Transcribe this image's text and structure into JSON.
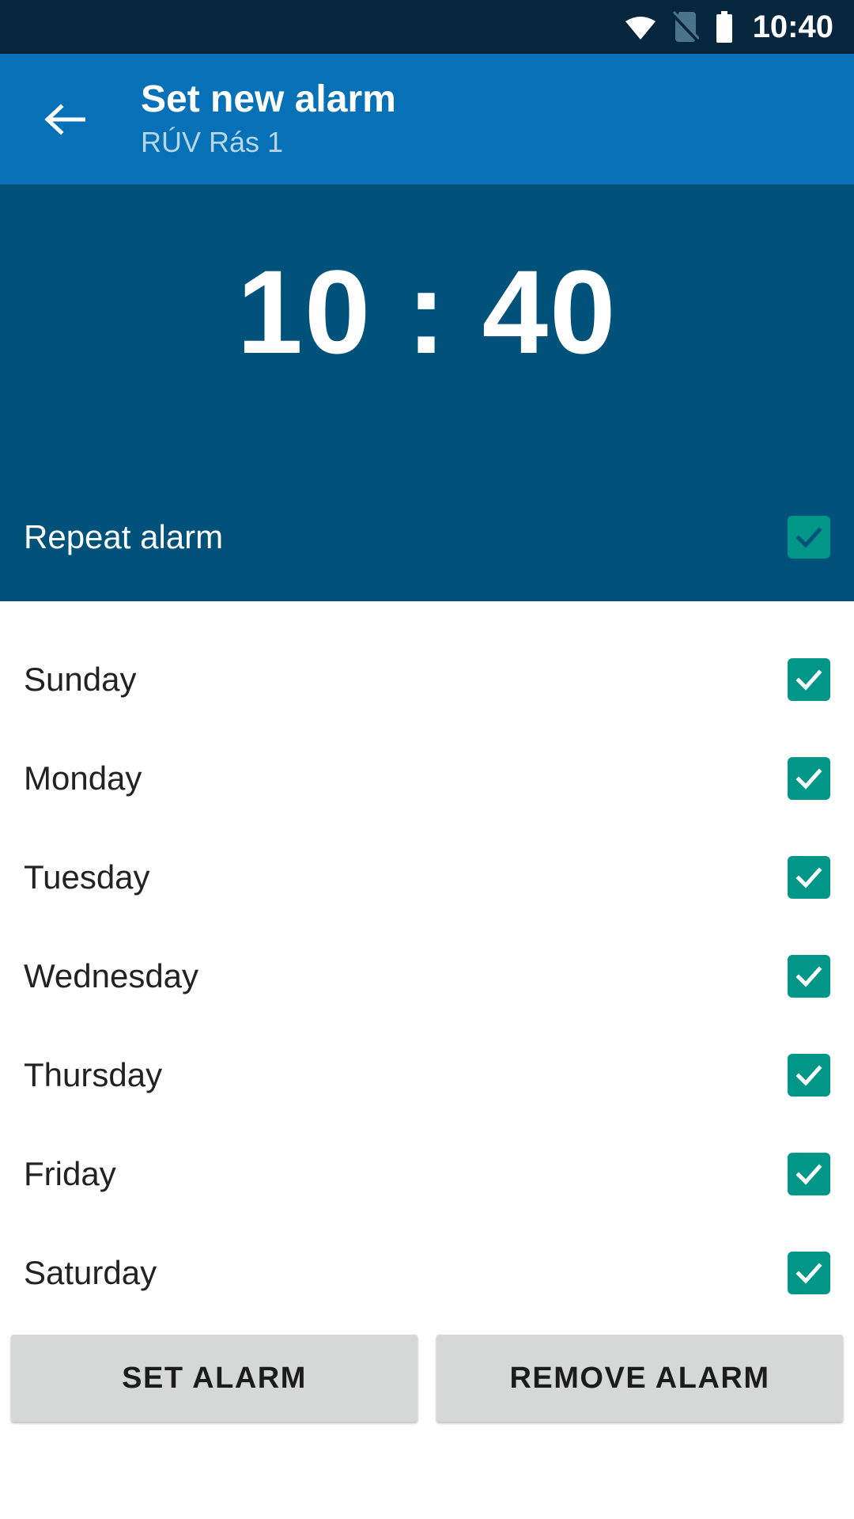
{
  "status_bar": {
    "clock": "10:40",
    "background": "#06263d",
    "icons": [
      {
        "name": "wifi-icon",
        "state": "connected"
      },
      {
        "name": "sim-card-off-icon",
        "state": "no-sim"
      },
      {
        "name": "battery-icon",
        "state": "full"
      }
    ]
  },
  "app_bar": {
    "background": "#0771b8",
    "back_icon": "arrow-left-icon",
    "title": "Set new alarm",
    "subtitle": "RÚV Rás 1"
  },
  "time_panel": {
    "background": "#00527a",
    "time": "10 : 40",
    "hour": "10",
    "minute": "40"
  },
  "repeat": {
    "label": "Repeat alarm",
    "checked": true,
    "accent": "#009688"
  },
  "days": [
    {
      "label": "Sunday",
      "checked": true
    },
    {
      "label": "Monday",
      "checked": true
    },
    {
      "label": "Tuesday",
      "checked": true
    },
    {
      "label": "Wednesday",
      "checked": true
    },
    {
      "label": "Thursday",
      "checked": true
    },
    {
      "label": "Friday",
      "checked": true
    },
    {
      "label": "Saturday",
      "checked": true
    }
  ],
  "buttons": {
    "set_alarm": "SET ALARM",
    "remove_alarm": "REMOVE ALARM",
    "background": "#d6d7d7"
  }
}
